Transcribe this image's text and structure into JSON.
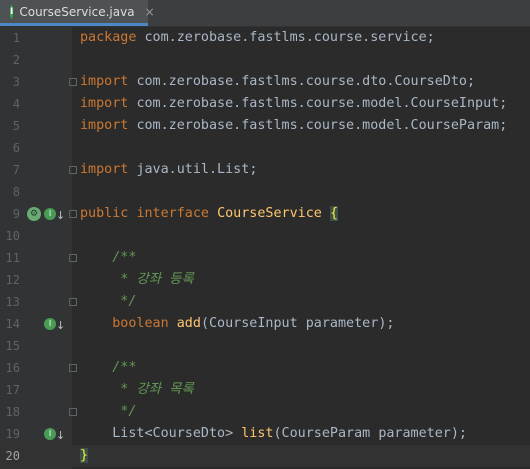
{
  "tab": {
    "icon_letter": "I",
    "title": "CourseService.java",
    "close": "×"
  },
  "lines": [
    {
      "n": "1",
      "tokens": [
        [
          "kw",
          "package "
        ],
        [
          "ty",
          "com.zerobase.fastlms.course.service"
        ],
        [
          "ty",
          ";"
        ]
      ]
    },
    {
      "n": "2",
      "tokens": []
    },
    {
      "n": "3",
      "tokens": [
        [
          "kw",
          "import "
        ],
        [
          "ty",
          "com.zerobase.fastlms.course.dto.CourseDto"
        ],
        [
          "ty",
          ";"
        ]
      ]
    },
    {
      "n": "4",
      "tokens": [
        [
          "kw",
          "import "
        ],
        [
          "ty",
          "com.zerobase.fastlms.course.model.CourseInput"
        ],
        [
          "ty",
          ";"
        ]
      ]
    },
    {
      "n": "5",
      "tokens": [
        [
          "kw",
          "import "
        ],
        [
          "ty",
          "com.zerobase.fastlms.course.model.CourseParam"
        ],
        [
          "ty",
          ";"
        ]
      ]
    },
    {
      "n": "6",
      "tokens": []
    },
    {
      "n": "7",
      "tokens": [
        [
          "kw",
          "import "
        ],
        [
          "ty",
          "java.util.List"
        ],
        [
          "ty",
          ";"
        ]
      ]
    },
    {
      "n": "8",
      "tokens": []
    },
    {
      "n": "9",
      "tokens": [
        [
          "kw",
          "public "
        ],
        [
          "iface",
          "interface "
        ],
        [
          "method",
          "CourseService "
        ],
        [
          "brace-hl",
          "{"
        ]
      ]
    },
    {
      "n": "10",
      "tokens": []
    },
    {
      "n": "11",
      "tokens": [
        [
          "cmt",
          "    /**"
        ]
      ]
    },
    {
      "n": "12",
      "tokens": [
        [
          "cmt",
          "     * 강좌 등록"
        ]
      ]
    },
    {
      "n": "13",
      "tokens": [
        [
          "cmt",
          "     */"
        ]
      ]
    },
    {
      "n": "14",
      "tokens": [
        [
          "kw",
          "    boolean "
        ],
        [
          "method",
          "add"
        ],
        [
          "ty",
          "(CourseInput "
        ],
        [
          "param",
          "parameter"
        ],
        [
          "ty",
          ");"
        ]
      ]
    },
    {
      "n": "15",
      "tokens": []
    },
    {
      "n": "16",
      "tokens": [
        [
          "cmt",
          "    /**"
        ]
      ]
    },
    {
      "n": "17",
      "tokens": [
        [
          "cmt",
          "     * 강좌 목록"
        ]
      ]
    },
    {
      "n": "18",
      "tokens": [
        [
          "cmt",
          "     */"
        ]
      ]
    },
    {
      "n": "19",
      "tokens": [
        [
          "ty",
          "    List<CourseDto> "
        ],
        [
          "method",
          "list"
        ],
        [
          "ty",
          "(CourseParam "
        ],
        [
          "param",
          "parameter"
        ],
        [
          "ty",
          ");"
        ]
      ]
    },
    {
      "n": "20",
      "tokens": [
        [
          "brace-hl",
          "}"
        ]
      ]
    }
  ],
  "gutter_icons": {
    "9": [
      "spring-icon",
      "implemented-icon"
    ],
    "14": [
      "implemented-icon"
    ],
    "19": [
      "implemented-icon"
    ]
  },
  "fold_lines": [
    "3",
    "7",
    "9",
    "11",
    "13",
    "16",
    "18"
  ],
  "current_line": "20",
  "icons": {
    "implemented-icon": "I",
    "implemented-arrow": "↓",
    "spring-icon": "⚙"
  }
}
